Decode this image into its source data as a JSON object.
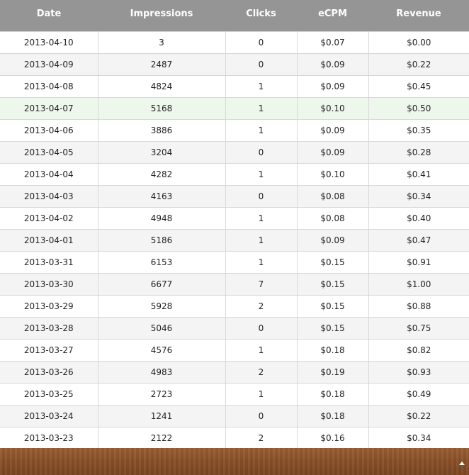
{
  "table": {
    "headers": [
      "Date",
      "Impressions",
      "Clicks",
      "eCPM",
      "Revenue"
    ],
    "rows": [
      [
        "2013-04-10",
        "3",
        "0",
        "$0.07",
        "$0.00"
      ],
      [
        "2013-04-09",
        "2487",
        "0",
        "$0.09",
        "$0.22"
      ],
      [
        "2013-04-08",
        "4824",
        "1",
        "$0.09",
        "$0.45"
      ],
      [
        "2013-04-07",
        "5168",
        "1",
        "$0.10",
        "$0.50"
      ],
      [
        "2013-04-06",
        "3886",
        "1",
        "$0.09",
        "$0.35"
      ],
      [
        "2013-04-05",
        "3204",
        "0",
        "$0.09",
        "$0.28"
      ],
      [
        "2013-04-04",
        "4282",
        "1",
        "$0.10",
        "$0.41"
      ],
      [
        "2013-04-03",
        "4163",
        "0",
        "$0.08",
        "$0.34"
      ],
      [
        "2013-04-02",
        "4948",
        "1",
        "$0.08",
        "$0.40"
      ],
      [
        "2013-04-01",
        "5186",
        "1",
        "$0.09",
        "$0.47"
      ],
      [
        "2013-03-31",
        "6153",
        "1",
        "$0.15",
        "$0.91"
      ],
      [
        "2013-03-30",
        "6677",
        "7",
        "$0.15",
        "$1.00"
      ],
      [
        "2013-03-29",
        "5928",
        "2",
        "$0.15",
        "$0.88"
      ],
      [
        "2013-03-28",
        "5046",
        "0",
        "$0.15",
        "$0.75"
      ],
      [
        "2013-03-27",
        "4576",
        "1",
        "$0.18",
        "$0.82"
      ],
      [
        "2013-03-26",
        "4983",
        "2",
        "$0.19",
        "$0.93"
      ],
      [
        "2013-03-25",
        "2723",
        "1",
        "$0.18",
        "$0.49"
      ],
      [
        "2013-03-24",
        "1241",
        "0",
        "$0.18",
        "$0.22"
      ],
      [
        "2013-03-23",
        "2122",
        "2",
        "$0.16",
        "$0.34"
      ]
    ],
    "highlighted_row": 3
  },
  "footer": {
    "scroll_icon": "chevron-up-icon"
  },
  "colors": {
    "header_bg": "#959595",
    "highlight_row_bg": "#eef7ec",
    "footer_wood": "#8a5129"
  }
}
